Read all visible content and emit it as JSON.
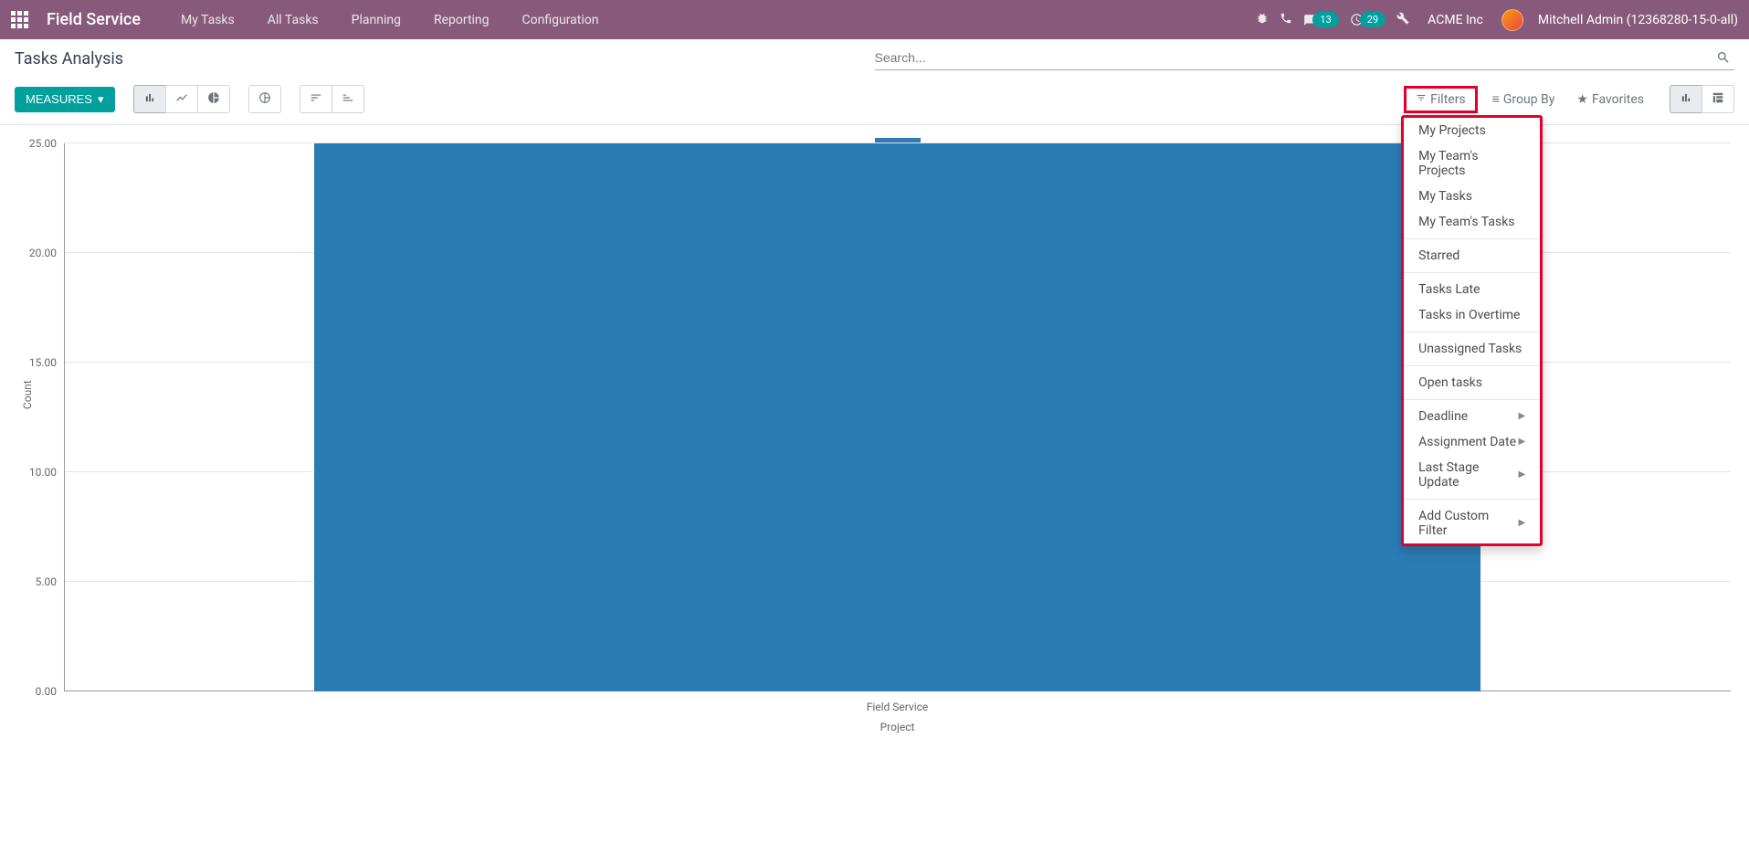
{
  "navbar": {
    "app_name": "Field Service",
    "menu_items": [
      "My Tasks",
      "All Tasks",
      "Planning",
      "Reporting",
      "Configuration"
    ],
    "badge_messages": "13",
    "badge_activities": "29",
    "company": "ACME Inc",
    "user": "Mitchell Admin (12368280-15-0-all)"
  },
  "control_panel": {
    "breadcrumb": "Tasks Analysis",
    "search_placeholder": "Search...",
    "measures_label": "MEASURES"
  },
  "search_options": {
    "filters": "Filters",
    "group_by": "Group By",
    "favorites": "Favorites"
  },
  "filter_dropdown": {
    "groups": [
      [
        "My Projects",
        "My Team's Projects",
        "My Tasks",
        "My Team's Tasks"
      ],
      [
        "Starred"
      ],
      [
        "Tasks Late",
        "Tasks in Overtime"
      ],
      [
        "Unassigned Tasks"
      ],
      [
        "Open tasks"
      ]
    ],
    "date_filters": [
      "Deadline",
      "Assignment Date",
      "Last Stage Update"
    ],
    "custom": "Add Custom Filter"
  },
  "chart_data": {
    "type": "bar",
    "categories": [
      "Field Service"
    ],
    "values": [
      25
    ],
    "ylabel": "Count",
    "xlabel": "Project",
    "ylim": [
      0,
      25
    ],
    "y_ticks": [
      "25.00",
      "20.00",
      "15.00",
      "10.00",
      "5.00",
      "0.00"
    ]
  }
}
